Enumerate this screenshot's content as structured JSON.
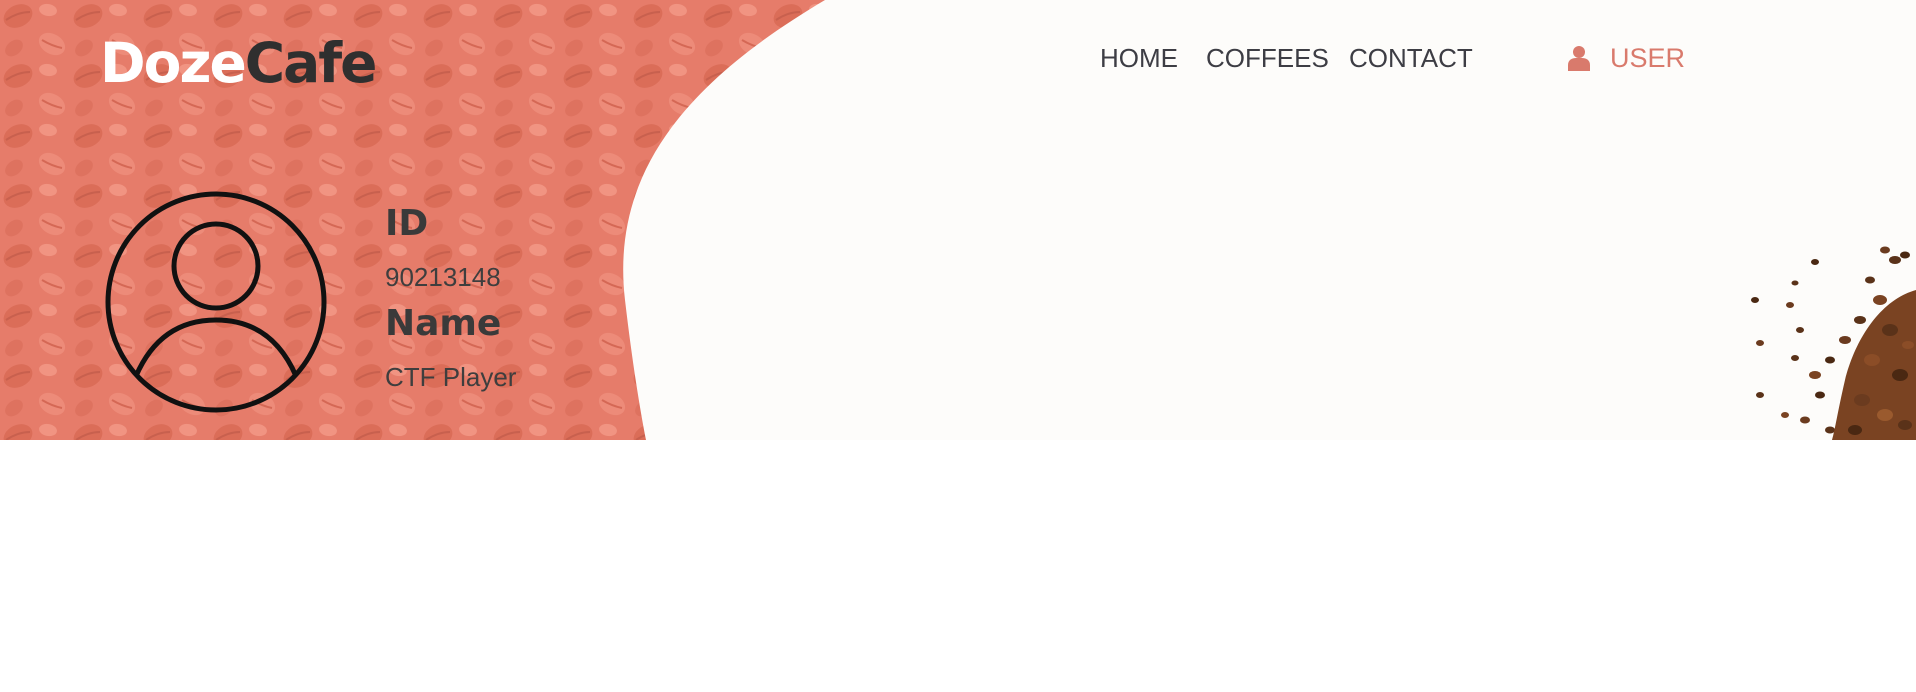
{
  "brand": {
    "logo_part1": "Doze",
    "logo_part2": "Cafe"
  },
  "nav": {
    "items": [
      {
        "label": "HOME"
      },
      {
        "label": "COFFEES"
      },
      {
        "label": "CONTACT"
      }
    ],
    "user": {
      "label": "USER",
      "icon": "user-icon"
    }
  },
  "profile": {
    "avatar_icon": "user-avatar-icon",
    "fields": [
      {
        "label": "ID",
        "value": "90213148"
      },
      {
        "label": "Name",
        "value": "CTF Player"
      }
    ]
  },
  "colors": {
    "hero_left": "#e67866",
    "hero_right": "#fdfcfa",
    "accent": "#d97a6c",
    "text_dark": "#3a3a3a"
  }
}
